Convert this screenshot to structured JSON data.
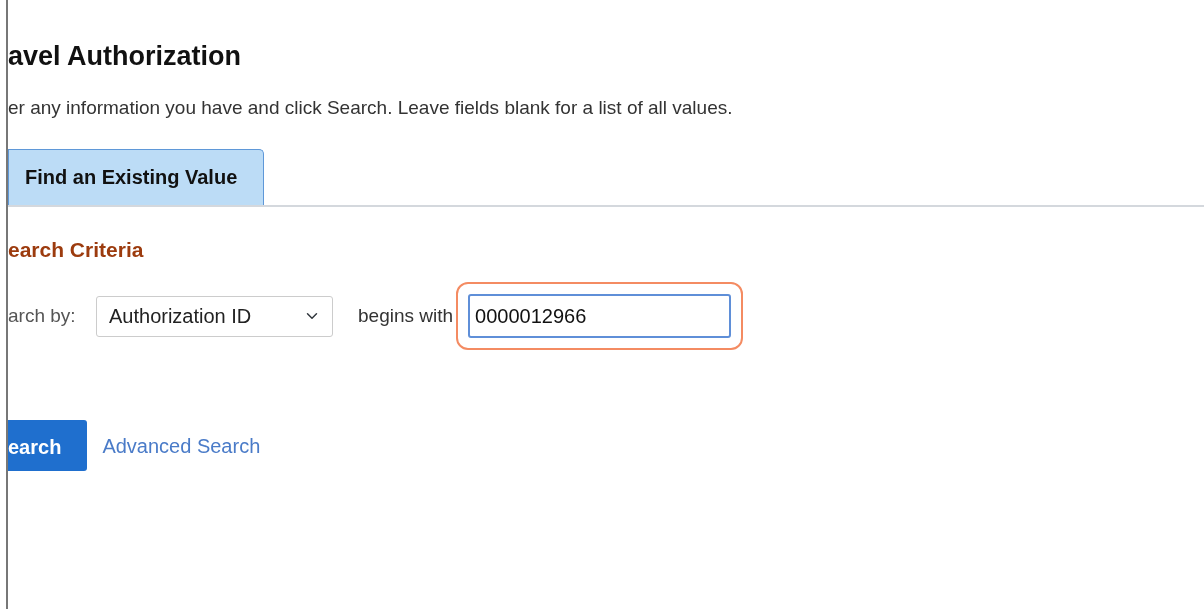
{
  "page_title": "avel Authorization",
  "instructions": "er any information you have and click Search. Leave fields blank for a list of all values.",
  "tabs": [
    {
      "label": "Find an Existing Value",
      "selected": true
    }
  ],
  "section_title": "earch Criteria",
  "criteria": {
    "label": "arch by:",
    "field": "Authorization ID",
    "operator": "begins with",
    "value": "0000012966",
    "highlighted": true
  },
  "search_button": "earch",
  "advanced_link": "Advanced Search"
}
